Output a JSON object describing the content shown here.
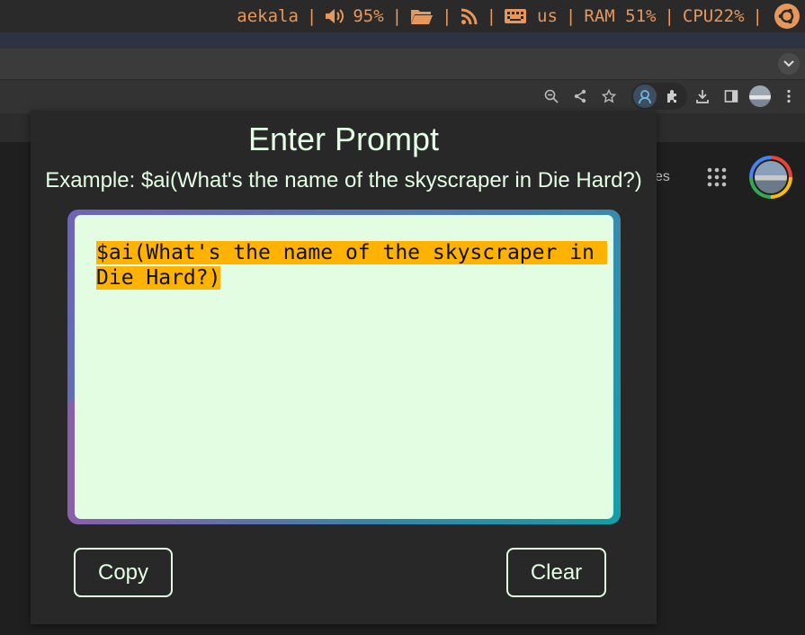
{
  "statusbar": {
    "user": "aekala",
    "volume": "95%",
    "keyboard_layout": "us",
    "ram": "RAM 51%",
    "cpu": "CPU22%",
    "separator": "|",
    "accent": "#e8975a"
  },
  "page": {
    "partial_text": "es"
  },
  "popup": {
    "title": "Enter Prompt",
    "example": "Example: $ai(What's the name of the skyscraper in Die Hard?)",
    "prompt_value": "$ai(What's the name of the skyscraper in Die Hard?)",
    "copy_label": "Copy",
    "clear_label": "Clear",
    "text_color": "#e3ffe3",
    "textarea_bg": "#e3fde3",
    "highlight_color": "#ffb300"
  },
  "icons": {
    "volume": "volume-icon",
    "folder": "folder-icon",
    "rss": "rss-icon",
    "keyboard": "keyboard-icon",
    "ubuntu": "ubuntu-logo-icon",
    "zoom": "zoom-out-icon",
    "share": "share-icon",
    "star": "bookmark-star-icon",
    "extension_profile": "extension-icon",
    "puzzle": "puzzle-icon",
    "download": "download-icon",
    "side_panel": "side-panel-icon",
    "profile": "profile-avatar-icon",
    "menu": "kebab-menu-icon",
    "apps": "apps-grid-icon"
  }
}
